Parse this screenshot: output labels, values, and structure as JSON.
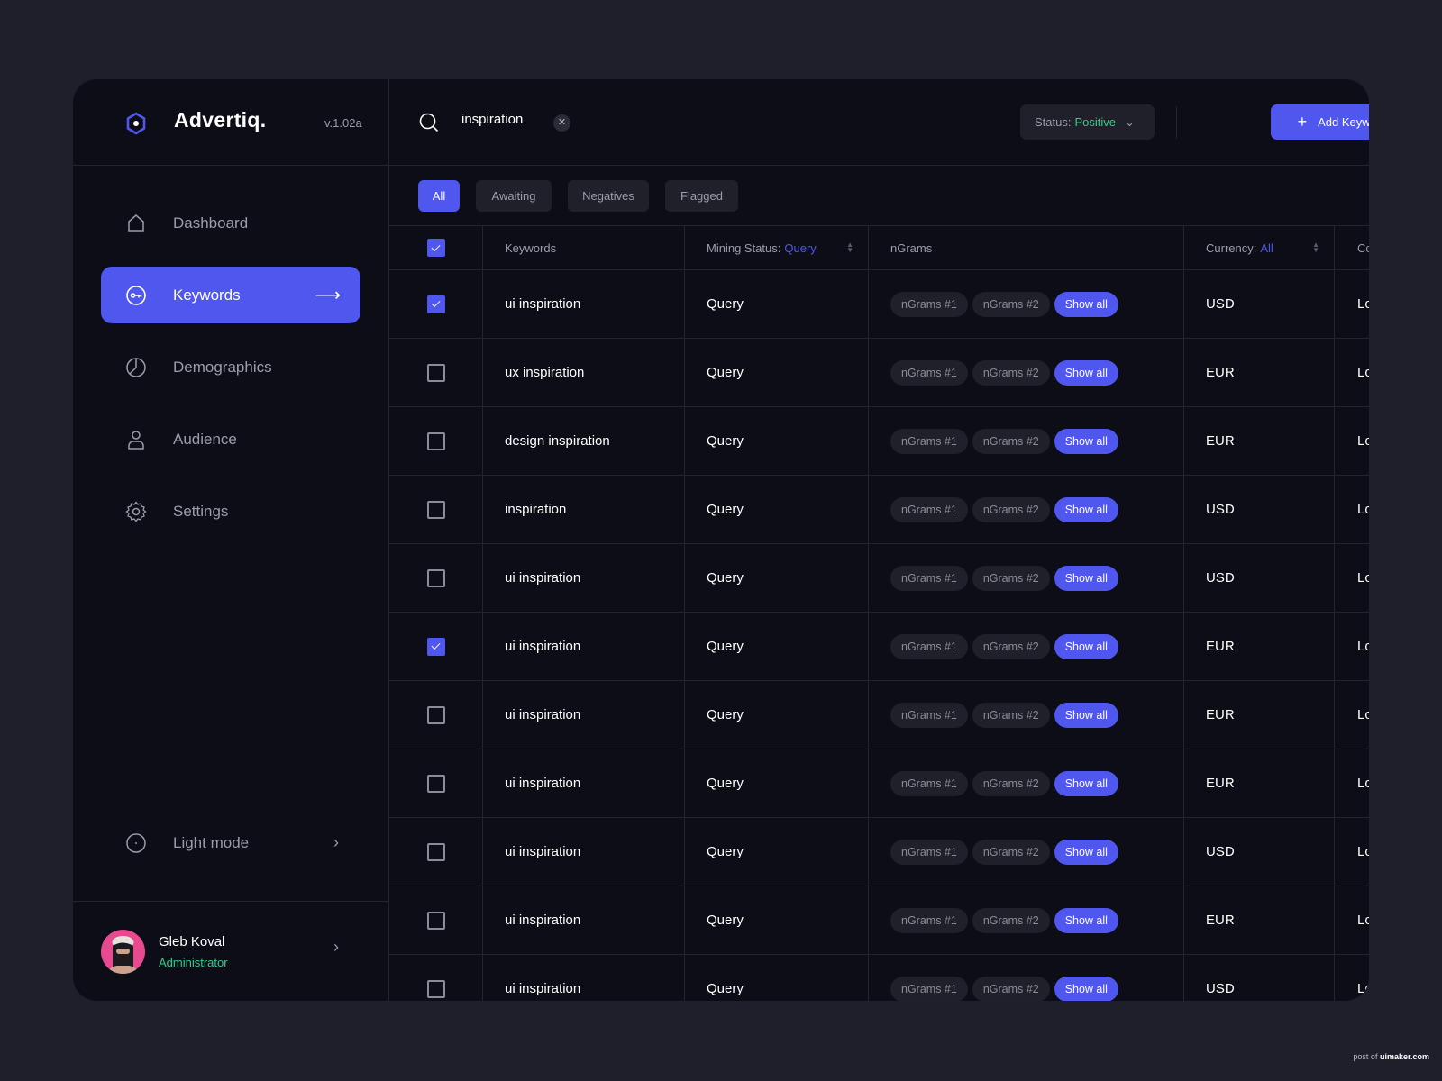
{
  "app": {
    "name": "Advertiq.",
    "version": "v.1.02a"
  },
  "sidebar": {
    "items": [
      {
        "label": "Dashboard",
        "icon": "home-icon"
      },
      {
        "label": "Keywords",
        "icon": "key-icon",
        "active": true
      },
      {
        "label": "Demographics",
        "icon": "pie-chart-icon"
      },
      {
        "label": "Audience",
        "icon": "user-icon"
      },
      {
        "label": "Settings",
        "icon": "gear-icon"
      }
    ],
    "light_mode": "Light mode"
  },
  "user": {
    "name": "Gleb Koval",
    "role": "Administrator"
  },
  "search": {
    "value": "inspiration"
  },
  "status_filter": {
    "label": "Status:",
    "value": "Positive"
  },
  "add_button": "Add Keyword",
  "tabs": [
    "All",
    "Awaiting",
    "Negatives",
    "Flagged"
  ],
  "table": {
    "headers": {
      "keywords": "Keywords",
      "mining_label": "Mining Status:",
      "mining_value": "Query",
      "ngrams": "nGrams",
      "currency_label": "Currency:",
      "currency_value": "All",
      "last": "Competition"
    },
    "header_checked": true,
    "ngram_pills": [
      "nGrams #1",
      "nGrams #2"
    ],
    "show_all": "Show all",
    "rows": [
      {
        "checked": true,
        "keyword": "ui inspiration",
        "status": "Query",
        "currency": "USD",
        "last": "Low"
      },
      {
        "checked": false,
        "keyword": "ux inspiration",
        "status": "Query",
        "currency": "EUR",
        "last": "Low"
      },
      {
        "checked": false,
        "keyword": "design inspiration",
        "status": "Query",
        "currency": "EUR",
        "last": "Low"
      },
      {
        "checked": false,
        "keyword": "inspiration",
        "status": "Query",
        "currency": "USD",
        "last": "Low"
      },
      {
        "checked": false,
        "keyword": "ui inspiration",
        "status": "Query",
        "currency": "USD",
        "last": "Low"
      },
      {
        "checked": true,
        "keyword": "ui inspiration",
        "status": "Query",
        "currency": "EUR",
        "last": "Low"
      },
      {
        "checked": false,
        "keyword": "ui inspiration",
        "status": "Query",
        "currency": "EUR",
        "last": "Low"
      },
      {
        "checked": false,
        "keyword": "ui inspiration",
        "status": "Query",
        "currency": "EUR",
        "last": "Low"
      },
      {
        "checked": false,
        "keyword": "ui inspiration",
        "status": "Query",
        "currency": "USD",
        "last": "Low"
      },
      {
        "checked": false,
        "keyword": "ui inspiration",
        "status": "Query",
        "currency": "EUR",
        "last": "Low"
      },
      {
        "checked": false,
        "keyword": "ui inspiration",
        "status": "Query",
        "currency": "USD",
        "last": "Low"
      }
    ]
  },
  "watermark": {
    "prefix": "post of",
    "site": "uimaker.com"
  },
  "colors": {
    "accent": "#4f57ef",
    "positive": "#2fcf8a",
    "background": "#1f1f2b",
    "panel": "#0d0d17"
  }
}
